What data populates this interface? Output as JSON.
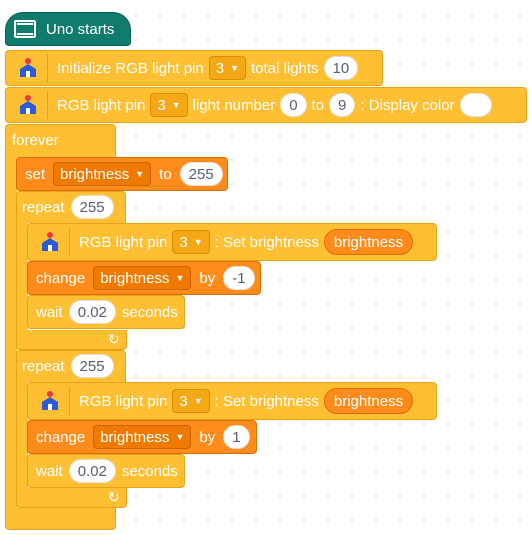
{
  "hat": {
    "label": "Uno starts",
    "board_top": "UNO"
  },
  "init_block": {
    "label_a": "Initialize RGB light pin",
    "pin": "3",
    "label_b": "total lights",
    "total": "10"
  },
  "display_block": {
    "label_a": "RGB light pin",
    "pin": "3",
    "label_b": "light number",
    "from": "0",
    "label_c": "to",
    "to": "9",
    "label_d": ": Display color"
  },
  "forever": {
    "label": "forever"
  },
  "set_block": {
    "label_a": "set",
    "variable": "brightness",
    "label_b": "to",
    "value": "255"
  },
  "repeat1": {
    "label": "repeat",
    "count": "255",
    "rgb": {
      "label_a": "RGB light pin",
      "pin": "3",
      "label_b": ": Set brightness",
      "reporter": "brightness"
    },
    "change": {
      "label_a": "change",
      "variable": "brightness",
      "label_b": "by",
      "value": "-1"
    },
    "wait": {
      "label_a": "wait",
      "value": "0.02",
      "label_b": "seconds"
    }
  },
  "repeat2": {
    "label": "repeat",
    "count": "255",
    "rgb": {
      "label_a": "RGB light pin",
      "pin": "3",
      "label_b": ": Set brightness",
      "reporter": "brightness"
    },
    "change": {
      "label_a": "change",
      "variable": "brightness",
      "label_b": "by",
      "value": "1"
    },
    "wait": {
      "label_a": "wait",
      "value": "0.02",
      "label_b": "seconds"
    }
  },
  "colors": {
    "gold": "#FFBF32",
    "orange": "#FF8C1A",
    "teal": "#0F7B6C",
    "icon_blue": "#2D5BD7"
  }
}
